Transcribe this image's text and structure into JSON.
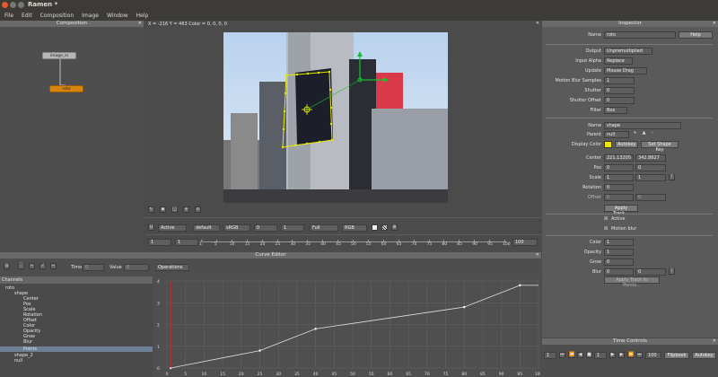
{
  "window": {
    "title": "Ramen *"
  },
  "menu": [
    "File",
    "Edit",
    "Composition",
    "Image",
    "Window",
    "Help"
  ],
  "composition": {
    "header": "Composition",
    "nodes": [
      {
        "label": "image_in"
      },
      {
        "label": "roto"
      }
    ]
  },
  "viewer": {
    "status": "X = -216 Y = 463 Color = 0, 0, 0, 0",
    "toolbar": {
      "channel_u": "U",
      "mode": "Active",
      "display": "default",
      "colorspace": "sRGB",
      "exposure": "0",
      "gamma": "1",
      "resolution": "Full",
      "channels": "RGB"
    },
    "timeline": {
      "start": "1",
      "current": "1",
      "end": "100",
      "ticks": [
        "1",
        "5",
        "10",
        "15",
        "20",
        "25",
        "30",
        "35",
        "40",
        "45",
        "50",
        "55",
        "60",
        "65",
        "70",
        "75",
        "80",
        "85",
        "90",
        "95",
        "100"
      ]
    }
  },
  "inspector": {
    "header": "Inspector",
    "name_label": "Name",
    "name_value": "roto",
    "help": "Help",
    "output_label": "Output",
    "output_value": "Unpremultiplied",
    "input_alpha_label": "Input Alpha",
    "input_alpha_value": "Replace",
    "update_label": "Update",
    "update_value": "Mouse Drag",
    "mb_samples_label": "Motion Blur Samples",
    "mb_samples_value": "1",
    "shutter_label": "Shutter",
    "shutter_value": "0",
    "shutter_offset_label": "Shutter Offset",
    "shutter_offset_value": "0",
    "filter_label": "Filter",
    "filter_value": "Box",
    "shape_name_label": "Name",
    "shape_name_value": "shape",
    "parent_label": "Parent",
    "parent_value": "null",
    "display_color_label": "Display Color",
    "autokey": "Autokey",
    "set_shape_key": "Set Shape Key",
    "display_color": "#f2e600",
    "center_label": "Center",
    "center_x": "221.13205",
    "center_y": "342.8627",
    "pos_label": "Pos",
    "pos_x": "0",
    "pos_y": "0",
    "scale_label": "Scale",
    "scale_x": "1",
    "scale_y": "1",
    "rotation_label": "Rotation",
    "rotation_value": "0",
    "offset_label": "Offset",
    "offset_x": "0",
    "offset_y": "0",
    "apply_track": "Apply Track...",
    "active_label": "Active",
    "motion_blur_label": "Motion blur",
    "color_label": "Color",
    "color_value": "1",
    "opacity_label": "Opacity",
    "opacity_value": "1",
    "grow_label": "Grow",
    "grow_value": "0",
    "blur_label": "Blur",
    "blur_x": "0",
    "blur_y": "0",
    "apply_track_points": "Apply Track to Points..."
  },
  "curve_editor": {
    "header": "Curve Editor",
    "time_label": "Time",
    "time_value": "0",
    "value_label": "Value",
    "value_value": "0",
    "operations": "Operations",
    "channels_header": "Channels",
    "channels": [
      "roto",
      "shape",
      "Center",
      "Pos",
      "Scale",
      "Rotation",
      "Offset",
      "Color",
      "Opacity",
      "Grow",
      "Blur",
      "Points",
      "shape_2",
      "null"
    ],
    "y_ticks": [
      "4",
      "3",
      "2",
      "1",
      "0"
    ],
    "x_ticks": [
      "0",
      "5",
      "10",
      "15",
      "20",
      "25",
      "30",
      "35",
      "40",
      "45",
      "50",
      "55",
      "60",
      "65",
      "70",
      "75",
      "80",
      "85",
      "90",
      "95",
      "100"
    ]
  },
  "time_controls": {
    "header": "Time Controls",
    "start": "1",
    "current": "1",
    "end": "100",
    "flipbook": "Flipbook",
    "autokey": "Autokey"
  },
  "chart_data": {
    "type": "line",
    "x": [
      1,
      25,
      40,
      80,
      95,
      100
    ],
    "y": [
      0,
      0.8,
      1.8,
      2.8,
      3.8,
      3.8
    ],
    "xlim": [
      0,
      100
    ],
    "ylim": [
      0,
      4
    ],
    "current_frame": 1
  }
}
